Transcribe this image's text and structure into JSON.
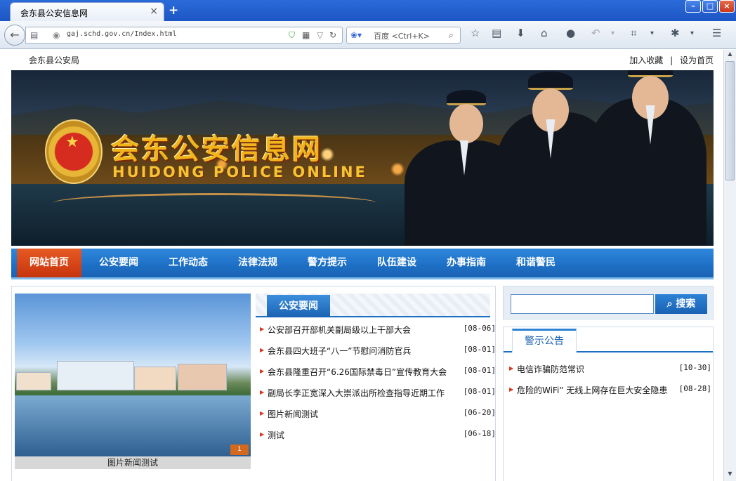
{
  "browser": {
    "tab_title": "会东县公安信息网",
    "tab_close": "×",
    "new_tab": "+",
    "url": "gaj.schd.gov.cn/Index.html",
    "search_placeholder": "百度 <Ctrl+K>"
  },
  "site": {
    "name": "会东县公安局",
    "links": [
      "加入收藏",
      "设为首页"
    ]
  },
  "banner": {
    "title": "会东公安信息网",
    "subtitle": "HUIDONG POLICE ONLINE"
  },
  "nav": {
    "items": [
      "网站首页",
      "公安要闻",
      "工作动态",
      "法律法规",
      "警方提示",
      "队伍建设",
      "办事指南",
      "和谐警民"
    ],
    "active_index": 0
  },
  "photo": {
    "caption": "图片新闻测试",
    "pager": "1"
  },
  "news": {
    "heading": "公安要闻",
    "items": [
      {
        "title": "公安部召开部机关副局级以上干部大会",
        "date": "[08-06]"
      },
      {
        "title": "会东县四大班子“八一”节慰问消防官兵",
        "date": "[08-01]"
      },
      {
        "title": "会东县隆重召开“6.26国际禁毒日”宣传教育大会",
        "date": "[08-01]"
      },
      {
        "title": "副局长李正宽深入大崇派出所检查指导近期工作",
        "date": "[08-01]"
      },
      {
        "title": "图片新闻测试",
        "date": "[06-20]"
      },
      {
        "title": "测试",
        "date": "[06-18]"
      }
    ]
  },
  "search": {
    "button": "搜索",
    "value": ""
  },
  "notice": {
    "heading": "警示公告",
    "items": [
      {
        "title": "电信诈骗防范常识",
        "date": "[10-30]"
      },
      {
        "title": "危险的WiFi” 无线上网存在巨大安全隐患",
        "date": "[08-28]"
      }
    ]
  },
  "colors": {
    "nav_blue": "#1d6fc4",
    "nav_active": "#d9461a",
    "browser_blue": "#2a6bd9"
  }
}
